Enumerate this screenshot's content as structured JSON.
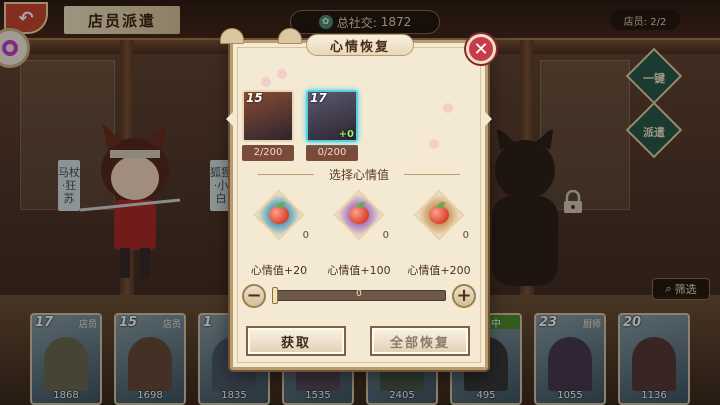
{
  "header": {
    "back_icon": "swirl-back-icon",
    "title": "店员派遣",
    "social_label": "总社交:",
    "social_value": "1872",
    "staff_label": "店员: 2/2"
  },
  "side_buttons": {
    "one_click": "一键",
    "send": "派遣"
  },
  "side_names": {
    "left": "马杖·狂苏",
    "right": "狐狸·小白"
  },
  "filter_label": "筛选",
  "cards": [
    {
      "level": "17",
      "role": "店员",
      "badge": "",
      "number": "1868",
      "color": "#6c6a52"
    },
    {
      "level": "15",
      "role": "店员",
      "badge": "",
      "number": "1698",
      "color": "#6a4a3a"
    },
    {
      "level": "1",
      "role": "",
      "badge": "",
      "number": "1835",
      "color": "#4d5a6a"
    },
    {
      "level": "",
      "role": "",
      "badge": "",
      "number": "1535",
      "color": "#5a4a5a"
    },
    {
      "level": "",
      "role": "",
      "badge": "",
      "number": "2405",
      "color": "#4a5a4a"
    },
    {
      "level": "",
      "role": "",
      "badge": "营业中",
      "number": "495",
      "color": "#3a3a3a"
    },
    {
      "level": "23",
      "role": "厨师",
      "badge": "",
      "number": "1055",
      "color": "#4a3a52"
    },
    {
      "level": "20",
      "role": "",
      "badge": "",
      "number": "1136",
      "color": "#5a3a3a"
    }
  ],
  "modal": {
    "title": "心情恢复",
    "close_icon": "close-x-icon",
    "characters": [
      {
        "level": "15",
        "mood": "2/200",
        "plus": "",
        "selected": false,
        "color": "#8a4c32"
      },
      {
        "level": "17",
        "mood": "0/200",
        "plus": "+0",
        "selected": true,
        "color": "#5b5a6e"
      }
    ],
    "section_title": "选择心情值",
    "items": [
      {
        "label": "心情值+20",
        "count": "0",
        "color": "#3c8fb0"
      },
      {
        "label": "心情值+100",
        "count": "0",
        "color": "#9a62b5"
      },
      {
        "label": "心情值+200",
        "count": "0",
        "color": "#c48a4a"
      }
    ],
    "slider": {
      "value": "0",
      "fraction": 0
    },
    "buttons": {
      "get": "获取",
      "restore_all": "全部恢复"
    }
  }
}
